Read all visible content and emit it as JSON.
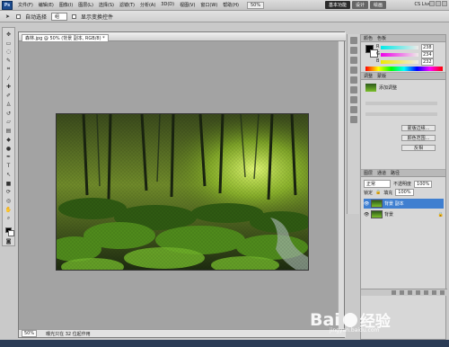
{
  "app": {
    "logo": "Ps",
    "menu": [
      "文件(F)",
      "编辑(E)",
      "图像(I)",
      "图层(L)",
      "选择(S)",
      "滤镜(T)",
      "分析(A)",
      "3D(D)",
      "视图(V)",
      "窗口(W)",
      "帮助(H)"
    ],
    "zoom": "50%",
    "workspaces": [
      "基本功能",
      "设计",
      "绘画"
    ],
    "cs_live": "CS Live"
  },
  "options": {
    "auto_select": "自动选择",
    "target": "组",
    "transform_controls": "显示变换控件"
  },
  "document": {
    "tab_title": "森林.jpg @ 50% (背景 副本, RGB/8) *",
    "status_zoom": "50%",
    "status_text": "曝光只在 32 位起作用"
  },
  "color_panel": {
    "title": "颜色",
    "swatches_tab": "色板",
    "r": "238",
    "g": "234",
    "b": "232"
  },
  "adjust_panel": {
    "title": "调整",
    "masks_tab": "蒙版",
    "preset_name": "添加调整",
    "btn1": "蒙版边缘...",
    "btn2": "颜色范围...",
    "btn3": "反相"
  },
  "layers_panel": {
    "title": "图层",
    "channels_tab": "通道",
    "paths_tab": "路径",
    "blend_mode": "正常",
    "opacity_label": "不透明度",
    "opacity": "100%",
    "lock_label": "锁定",
    "fill_label": "填充",
    "fill": "100%",
    "layers": [
      {
        "name": "背景 副本",
        "selected": true
      },
      {
        "name": "背景",
        "selected": false
      }
    ]
  },
  "watermark": {
    "brand": "Bai",
    "brand2": "经验",
    "site": "jingyan.baidu.com"
  },
  "colors": {
    "accent": "#3f7fd0"
  }
}
